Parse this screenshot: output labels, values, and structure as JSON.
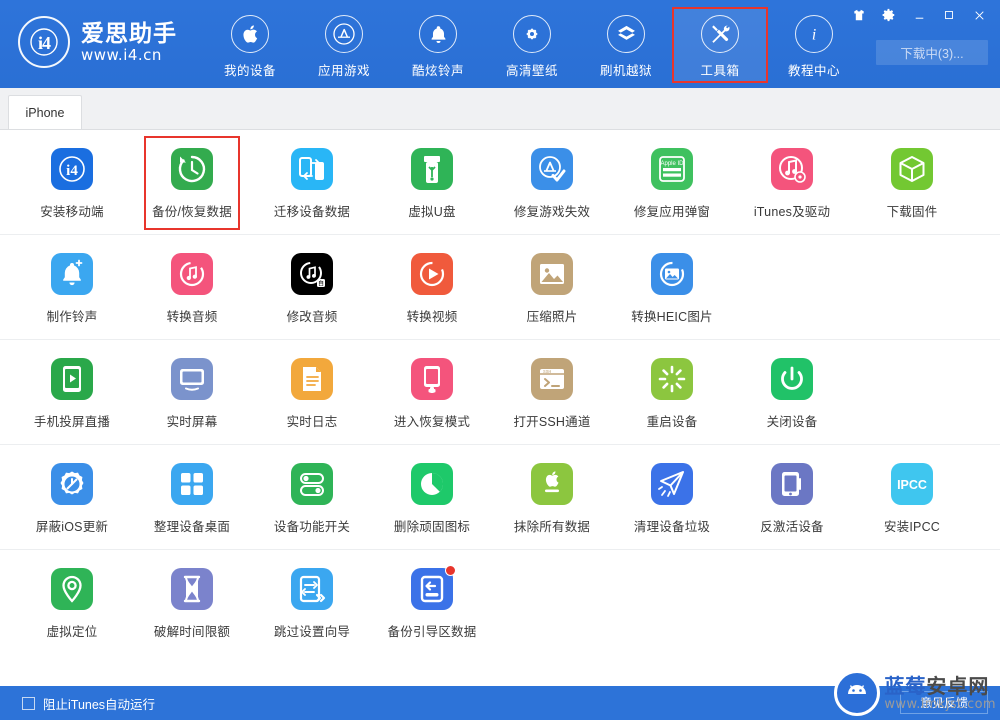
{
  "app": {
    "brand_title": "爱思助手",
    "brand_url": "www.i4.cn",
    "brand_logo_text": "i4",
    "accent_color": "#2d73d8",
    "highlight_color": "#e8352c"
  },
  "header": {
    "nav": [
      {
        "label": "我的设备",
        "icon": "apple-icon",
        "active": false,
        "highlight": false
      },
      {
        "label": "应用游戏",
        "icon": "appstore-icon",
        "active": false,
        "highlight": false
      },
      {
        "label": "酷炫铃声",
        "icon": "bell-icon",
        "active": false,
        "highlight": false
      },
      {
        "label": "高清壁纸",
        "icon": "flower-icon",
        "active": false,
        "highlight": false
      },
      {
        "label": "刷机越狱",
        "icon": "box-open-icon",
        "active": false,
        "highlight": false
      },
      {
        "label": "工具箱",
        "icon": "tools-icon",
        "active": true,
        "highlight": true
      },
      {
        "label": "教程中心",
        "icon": "info-icon",
        "active": false,
        "highlight": false
      }
    ],
    "window_controls": [
      {
        "name": "skin-icon",
        "glyph": "♟"
      },
      {
        "name": "settings-gear-icon",
        "glyph": "⚙"
      },
      {
        "name": "minimize-icon",
        "glyph": "—"
      },
      {
        "name": "maximize-icon",
        "glyph": "☐"
      },
      {
        "name": "close-icon",
        "glyph": "✕"
      }
    ],
    "download_button": "下载中(3)..."
  },
  "tabs": [
    {
      "label": "iPhone",
      "active": true
    }
  ],
  "toolbox": {
    "rows": [
      [
        {
          "label": "安装移动端",
          "icon": "i4-app-icon",
          "color": "#1a6ee0",
          "glyph": "ⓘ4",
          "badge": false,
          "highlight": false
        },
        {
          "label": "备份/恢复数据",
          "icon": "backup-restore-icon",
          "color": "#33ab4e",
          "glyph": "↺",
          "badge": false,
          "highlight": true
        },
        {
          "label": "迁移设备数据",
          "icon": "device-transfer-icon",
          "color": "#29b6f6",
          "glyph": "⇄",
          "badge": false,
          "highlight": false
        },
        {
          "label": "虚拟U盘",
          "icon": "usb-drive-icon",
          "color": "#2fb457",
          "glyph": "⇟",
          "badge": false,
          "highlight": false
        },
        {
          "label": "修复游戏失效",
          "icon": "fix-game-icon",
          "color": "#3b8fe8",
          "glyph": "✓",
          "badge": false,
          "highlight": false
        },
        {
          "label": "修复应用弹窗",
          "icon": "appleid-fix-icon",
          "color": "#3fc15f",
          "glyph": "Apple ID",
          "badge": false,
          "highlight": false
        },
        {
          "label": "iTunes及驱动",
          "icon": "itunes-driver-icon",
          "color": "#f4547c",
          "glyph": "♪",
          "badge": false,
          "highlight": false
        },
        {
          "label": "下载固件",
          "icon": "firmware-box-icon",
          "color": "#73c832",
          "glyph": "▣",
          "badge": false,
          "highlight": false
        }
      ],
      [
        {
          "label": "制作铃声",
          "icon": "make-ringtone-icon",
          "color": "#3ba7f0",
          "glyph": "🔔",
          "badge": false,
          "highlight": false
        },
        {
          "label": "转换音频",
          "icon": "convert-audio-icon",
          "color": "#f4547c",
          "glyph": "♫",
          "badge": false,
          "highlight": false
        },
        {
          "label": "修改音频",
          "icon": "edit-audio-icon",
          "color": "#c0a municipality",
          "glyph": "♫",
          "badge": false,
          "highlight": false
        },
        {
          "label": "转换视频",
          "icon": "convert-video-icon",
          "color": "#f05a3c",
          "glyph": "▶",
          "badge": false,
          "highlight": false
        },
        {
          "label": "压缩照片",
          "icon": "compress-photo-icon",
          "color": "#c0a478",
          "glyph": "🖼",
          "badge": false,
          "highlight": false
        },
        {
          "label": "转换HEIC图片",
          "icon": "convert-heic-icon",
          "color": "#3b8fe8",
          "glyph": "🖼",
          "badge": false,
          "highlight": false
        }
      ],
      [
        {
          "label": "手机投屏直播",
          "icon": "screen-cast-icon",
          "color": "#2aa84a",
          "glyph": "▶",
          "badge": false,
          "highlight": false
        },
        {
          "label": "实时屏幕",
          "icon": "realtime-screen-icon",
          "color": "#7b93cc",
          "glyph": "🖵",
          "badge": false,
          "highlight": false
        },
        {
          "label": "实时日志",
          "icon": "realtime-log-icon",
          "color": "#f2a83c",
          "glyph": "▤",
          "badge": false,
          "highlight": false
        },
        {
          "label": "进入恢复模式",
          "icon": "recovery-mode-icon",
          "color": "#f4547c",
          "glyph": "▯",
          "badge": false,
          "highlight": false
        },
        {
          "label": "打开SSH通道",
          "icon": "ssh-tunnel-icon",
          "color": "#c0a478",
          "glyph": ">_",
          "badge": false,
          "highlight": false
        },
        {
          "label": "重启设备",
          "icon": "reboot-device-icon",
          "color": "#8cc63f",
          "glyph": "✳",
          "badge": false,
          "highlight": false
        },
        {
          "label": "关闭设备",
          "icon": "power-off-icon",
          "color": "#21c268",
          "glyph": "⏻",
          "badge": false,
          "highlight": false
        }
      ],
      [
        {
          "label": "屏蔽iOS更新",
          "icon": "block-ios-update-icon",
          "color": "#3b8fe8",
          "glyph": "⚙",
          "badge": false,
          "highlight": false
        },
        {
          "label": "整理设备桌面",
          "icon": "organize-desktop-icon",
          "color": "#3ba7f0",
          "glyph": "▦",
          "badge": false,
          "highlight": false
        },
        {
          "label": "设备功能开关",
          "icon": "feature-toggle-icon",
          "color": "#2fb457",
          "glyph": "◉",
          "badge": false,
          "highlight": false
        },
        {
          "label": "删除顽固图标",
          "icon": "remove-icon-icon",
          "color": "#1ec96a",
          "glyph": "◷",
          "badge": false,
          "highlight": false
        },
        {
          "label": "抹除所有数据",
          "icon": "erase-all-data-icon",
          "color": "#8cc63f",
          "glyph": "",
          "badge": false,
          "highlight": false
        },
        {
          "label": "清理设备垃圾",
          "icon": "clean-junk-icon",
          "color": "#3b72e8",
          "glyph": "✈",
          "badge": false,
          "highlight": false
        },
        {
          "label": "反激活设备",
          "icon": "deactivate-device-icon",
          "color": "#6b77c4",
          "glyph": "▯",
          "badge": false,
          "highlight": false
        },
        {
          "label": "安装IPCC",
          "icon": "install-ipcc-icon",
          "color": "#3fc6ef",
          "glyph": "IPCC",
          "badge": false,
          "highlight": false
        }
      ],
      [
        {
          "label": "虚拟定位",
          "icon": "virtual-location-icon",
          "color": "#2fb457",
          "glyph": "◎",
          "badge": false,
          "highlight": false
        },
        {
          "label": "破解时间限额",
          "icon": "crack-screentime-icon",
          "color": "#7b83cc",
          "glyph": "⌛",
          "badge": false,
          "highlight": false
        },
        {
          "label": "跳过设置向导",
          "icon": "skip-setup-icon",
          "color": "#3ba7f0",
          "glyph": "⇥",
          "badge": false,
          "highlight": false
        },
        {
          "label": "备份引导区数据",
          "icon": "backup-boot-data-icon",
          "color": "#3b72e8",
          "glyph": "↩",
          "badge": true,
          "highlight": false
        }
      ]
    ]
  },
  "footer": {
    "checkbox_label": "阻止iTunes自动运行",
    "checkbox_checked": false,
    "feedback_button": "意见反馈"
  },
  "watermark": {
    "text_blue": "蓝莓",
    "text_dark": "安卓网",
    "url": "www.lmkjst.com"
  }
}
